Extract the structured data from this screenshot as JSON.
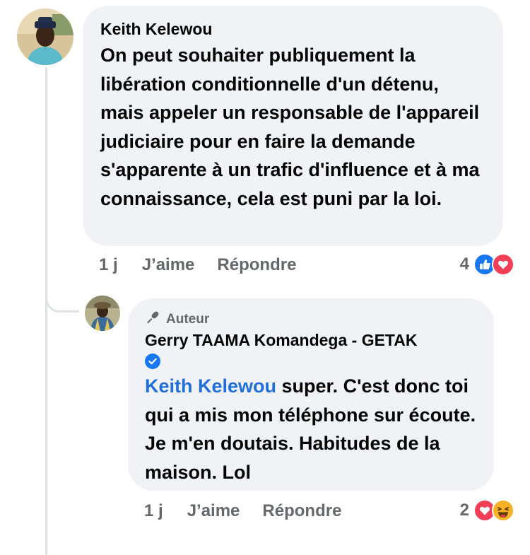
{
  "comments": [
    {
      "author": "Keith Kelewou",
      "text": "On peut souhaiter publiquement la libération conditionnelle d'un détenu, mais appeler un responsable de l'appareil judiciaire pour en faire la demande s'apparente à un trafic d'influence et à ma connaissance, cela est puni par la loi.",
      "time": "1 j",
      "like_label": "J’aime",
      "reply_label": "Répondre",
      "reaction_count": "4",
      "reactions": [
        "like-icon",
        "love-icon"
      ]
    }
  ],
  "reply": {
    "badge": "Auteur",
    "author": "Gerry TAAMA Komandega - GETAK",
    "verified": true,
    "mention": "Keith Kelewou",
    "text": " super. C'est donc toi qui a mis mon téléphone sur écoute. Je m'en doutais. Habitudes de la maison. Lol",
    "time": "1 j",
    "like_label": "J’aime",
    "reply_label": "Répondre",
    "reaction_count": "2",
    "reactions": [
      "love-icon",
      "haha-icon"
    ]
  },
  "colors": {
    "bubble": "#f0f2f5",
    "meta": "#65676b",
    "mention": "#216fdb",
    "like": "#1877f2",
    "love": "#f33e58",
    "haha": "#f7b125"
  }
}
